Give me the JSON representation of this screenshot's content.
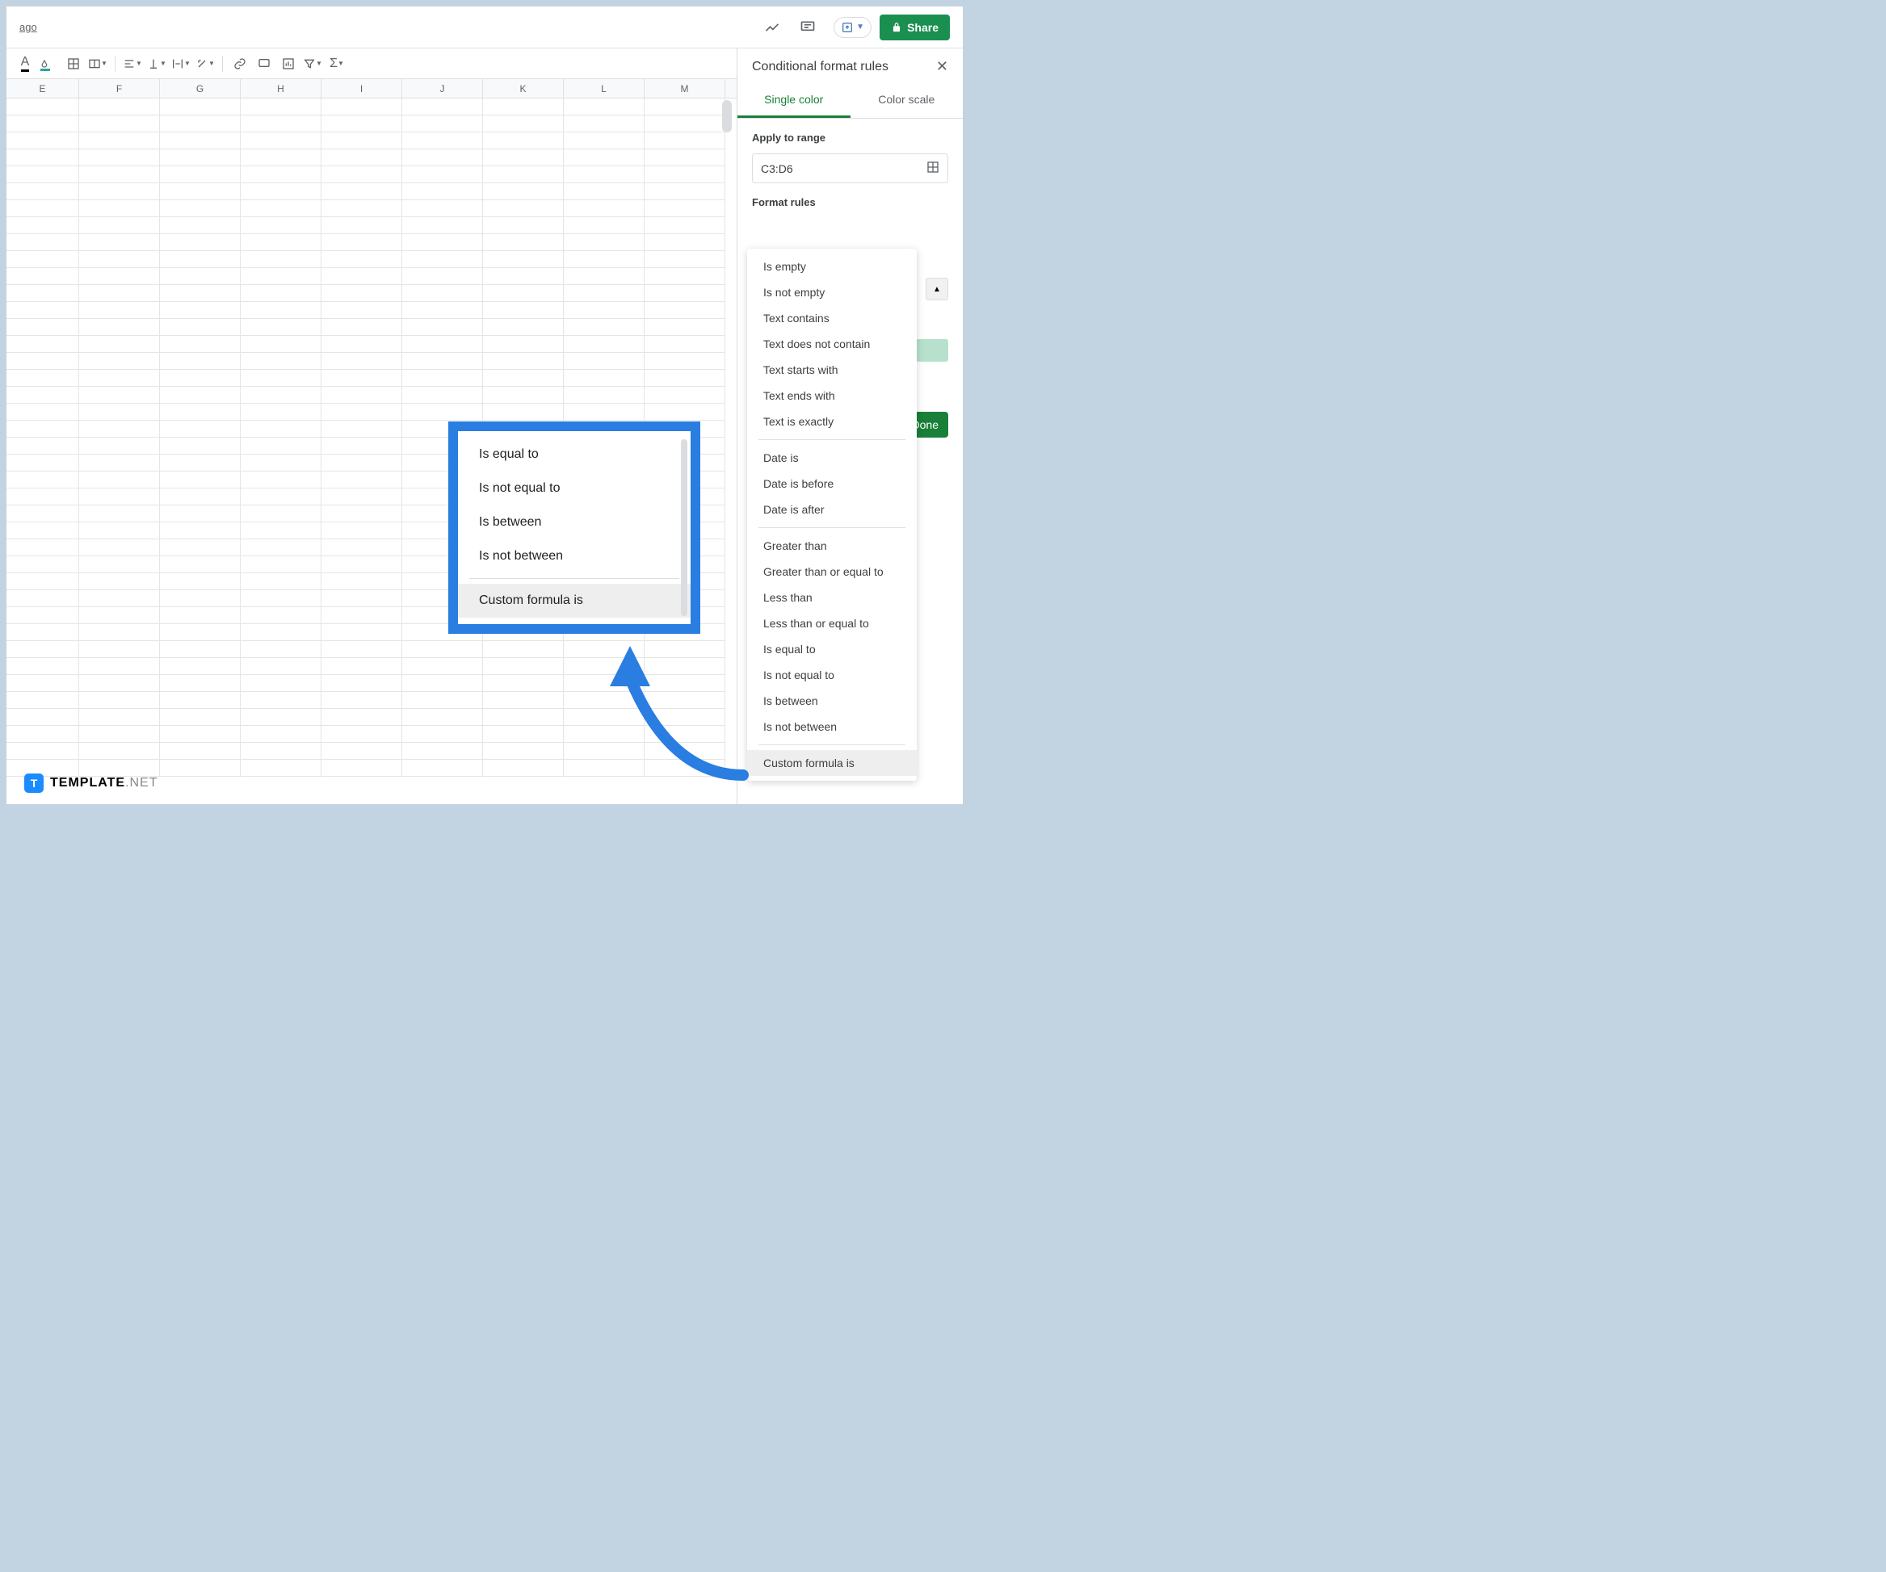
{
  "topbar": {
    "left_text": "ago",
    "share_label": "Share"
  },
  "columns": [
    "E",
    "F",
    "G",
    "H",
    "I",
    "J",
    "K",
    "L",
    "M"
  ],
  "sidebar": {
    "title": "Conditional format rules",
    "tabs": {
      "single": "Single color",
      "scale": "Color scale"
    },
    "apply_label": "Apply to range",
    "range_value": "C3:D6",
    "rules_label": "Format rules",
    "done_label": "Done"
  },
  "dropdown": {
    "groups": [
      [
        "Is empty",
        "Is not empty",
        "Text contains",
        "Text does not contain",
        "Text starts with",
        "Text ends with",
        "Text is exactly"
      ],
      [
        "Date is",
        "Date is before",
        "Date is after"
      ],
      [
        "Greater than",
        "Greater than or equal to",
        "Less than",
        "Less than or equal to",
        "Is equal to",
        "Is not equal to",
        "Is between",
        "Is not between"
      ],
      [
        "Custom formula is"
      ]
    ],
    "selected": "Custom formula is"
  },
  "callout": {
    "items_top": [
      "Is equal to",
      "Is not equal to",
      "Is between",
      "Is not between"
    ],
    "item_selected": "Custom formula is"
  },
  "watermark": {
    "badge": "T",
    "bold": "TEMPLATE",
    "net": ".NET"
  }
}
